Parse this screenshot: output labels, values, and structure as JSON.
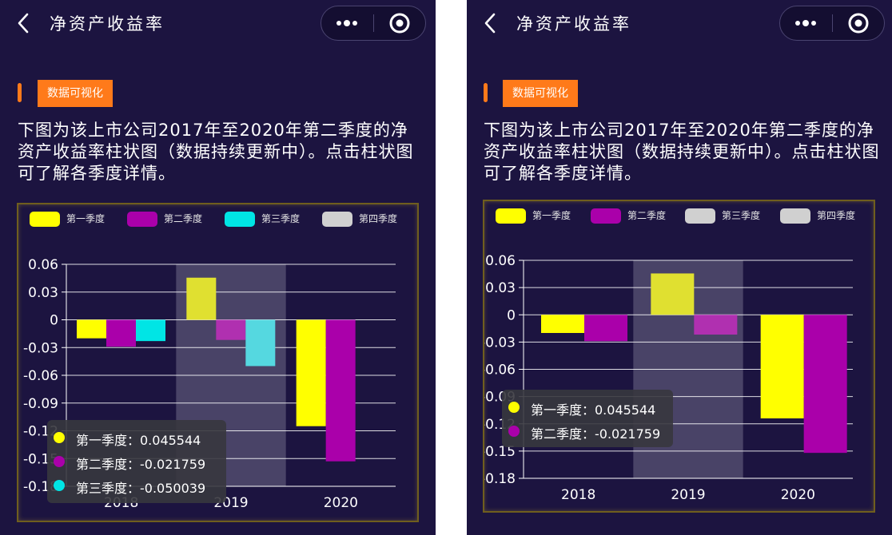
{
  "left": {
    "nav": {
      "title": "净资产收益率"
    },
    "section_tag": "数据可视化",
    "description": "下图为该上市公司2017年至2020年第二季度的净资产收益率柱状图（数据持续更新中）。点击柱状图可了解各季度详情。",
    "legend": [
      {
        "label": "第一季度",
        "color": "#ffff00"
      },
      {
        "label": "第二季度",
        "color": "#aa00aa"
      },
      {
        "label": "第三季度",
        "color": "#00e5e5"
      },
      {
        "label": "第四季度",
        "color": "#d0d0d0"
      }
    ],
    "tooltip": [
      {
        "label": "第一季度：0.045544",
        "color": "#ffff00"
      },
      {
        "label": "第二季度：-0.021759",
        "color": "#aa00aa"
      },
      {
        "label": "第三季度：-0.050039",
        "color": "#00e5e5"
      }
    ]
  },
  "right": {
    "nav": {
      "title": "净资产收益率"
    },
    "section_tag": "数据可视化",
    "description": "下图为该上市公司2017年至2020年第二季度的净资产收益率柱状图（数据持续更新中）。点击柱状图可了解各季度详情。",
    "legend": [
      {
        "label": "第一季度",
        "color": "#ffff00"
      },
      {
        "label": "第二季度",
        "color": "#aa00aa"
      },
      {
        "label": "第三季度",
        "color": "#d0d0d0"
      },
      {
        "label": "第四季度",
        "color": "#d0d0d0"
      }
    ],
    "tooltip": [
      {
        "label": "第一季度：0.045544",
        "color": "#ffff00"
      },
      {
        "label": "第二季度：-0.021759",
        "color": "#aa00aa"
      }
    ]
  },
  "chart_data": [
    {
      "type": "bar",
      "categories": [
        "2018",
        "2019",
        "2020"
      ],
      "series": [
        {
          "name": "第一季度",
          "color": "#ffff00",
          "values": [
            -0.02,
            0.045544,
            -0.115
          ]
        },
        {
          "name": "第二季度",
          "color": "#aa00aa",
          "values": [
            -0.029,
            -0.021759,
            -0.153
          ]
        },
        {
          "name": "第三季度",
          "color": "#00e5e5",
          "values": [
            -0.023,
            -0.050039,
            null
          ]
        }
      ],
      "yticks": [
        "0.06",
        "0.03",
        "0",
        "-0.03",
        "-0.06",
        "-0.09",
        "-0.12",
        "-0.15",
        "-0.18"
      ],
      "ylim": [
        -0.18,
        0.06
      ],
      "highlight_category": "2019",
      "grid": true
    },
    {
      "type": "bar",
      "categories": [
        "2018",
        "2019",
        "2020"
      ],
      "series": [
        {
          "name": "第一季度",
          "color": "#ffff00",
          "values": [
            -0.02,
            0.045544,
            -0.114
          ]
        },
        {
          "name": "第二季度",
          "color": "#aa00aa",
          "values": [
            -0.029,
            -0.021759,
            -0.152
          ]
        }
      ],
      "yticks": [
        "0.06",
        "0.03",
        "0",
        "-0.03",
        "-0.06",
        "-0.09",
        "-0.12",
        "-0.15",
        "-0.18"
      ],
      "ylim": [
        -0.18,
        0.06
      ],
      "highlight_category": "2019",
      "grid": true
    }
  ]
}
